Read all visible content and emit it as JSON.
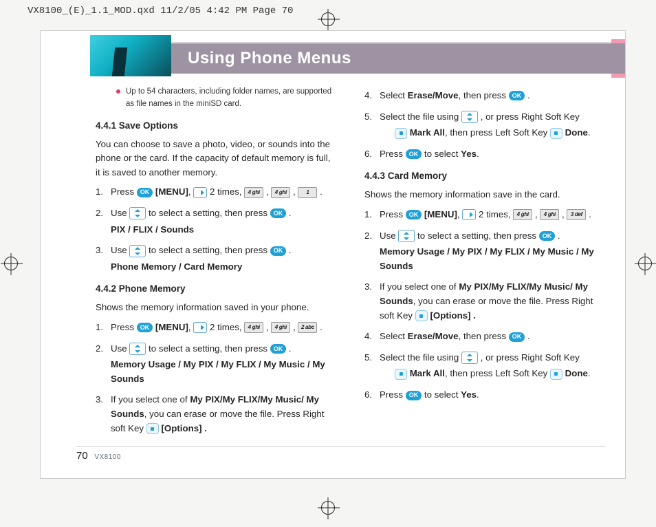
{
  "prepress_header": "VX8100_(E)_1.1_MOD.qxd  11/2/05  4:42 PM  Page 70",
  "title": "Using Phone Menus",
  "note_bullet": "Up to 54 characters, including folder names, are supported as file names in the miniSD card.",
  "icons": {
    "ok": "OK"
  },
  "keys": {
    "k4": "4 ghi",
    "k1": "1",
    "k2": "2 abc",
    "k3": "3 def"
  },
  "left": {
    "s441_head": "4.4.1 Save Options",
    "s441_intro": "You can choose to save a photo, video, or sounds into the phone or the card. If the capacity of default memory is full, it is saved to another memory.",
    "s441_step1_a": "Press ",
    "s441_step1_b": " [MENU]",
    "s441_step1_c": ", ",
    "s441_step1_d": " 2 times, ",
    "s441_step2_a": "Use ",
    "s441_step2_b": " to select a setting, then press ",
    "s441_step2_opts": "PIX / FLIX / Sounds",
    "s441_step3_a": "Use ",
    "s441_step3_b": " to select a setting, then press ",
    "s441_step3_opts": "Phone Memory / Card Memory",
    "s442_head": "4.4.2 Phone Memory",
    "s442_intro": "Shows the memory information saved in your phone.",
    "s442_step1_a": "Press ",
    "s442_step1_b": " [MENU]",
    "s442_step1_c": ", ",
    "s442_step1_d": " 2 times, ",
    "s442_step2_a": "Use ",
    "s442_step2_b": " to select a setting, then press ",
    "s442_step2_opts": "Memory Usage / My PIX / My FLIX / My Music / My Sounds",
    "s442_step3_a": "If you select one of ",
    "s442_step3_b": "My PIX/My FLIX/My Music/ My Sounds",
    "s442_step3_c": ", you can erase or move the file. Press Right soft Key ",
    "s442_step3_d": " [Options] ."
  },
  "right": {
    "r_step4_a": "Select ",
    "r_step4_b": "Erase/Move",
    "r_step4_c": ", then press ",
    "r_step5_a": "Select the file using ",
    "r_step5_b": " , or press Right Soft Key ",
    "r_step5_c": "Mark All",
    "r_step5_d": ", then press Left Soft Key ",
    "r_step5_e": "Done",
    "r_step6_a": "Press ",
    "r_step6_b": " to select ",
    "r_step6_c": "Yes",
    "s443_head": "4.4.3 Card Memory",
    "s443_intro": "Shows the memory information save in the card.",
    "s443_step1_a": "Press ",
    "s443_step1_b": " [MENU]",
    "s443_step1_c": ", ",
    "s443_step1_d": " 2 times, ",
    "s443_step2_a": "Use ",
    "s443_step2_b": " to select a setting, then press ",
    "s443_step2_opts": "Memory Usage / My PIX / My FLIX / My Music / My Sounds",
    "s443_step3_a": "If you select one of ",
    "s443_step3_b": "My PIX/My FLIX/My Music/ My Sounds",
    "s443_step3_c": ", you can erase or move the file. Press Right soft Key ",
    "s443_step3_d": " [Options] .",
    "s443_step4_a": "Select ",
    "s443_step4_b": "Erase/Move",
    "s443_step4_c": ", then press ",
    "s443_step5_a": "Select the file using ",
    "s443_step5_b": " , or press Right Soft Key ",
    "s443_step5_c": "Mark All",
    "s443_step5_d": ", then press Left Soft Key ",
    "s443_step5_e": "Done",
    "s443_step6_a": "Press ",
    "s443_step6_b": " to select ",
    "s443_step6_c": "Yes"
  },
  "footer": {
    "page": "70",
    "model": "VX8100"
  }
}
